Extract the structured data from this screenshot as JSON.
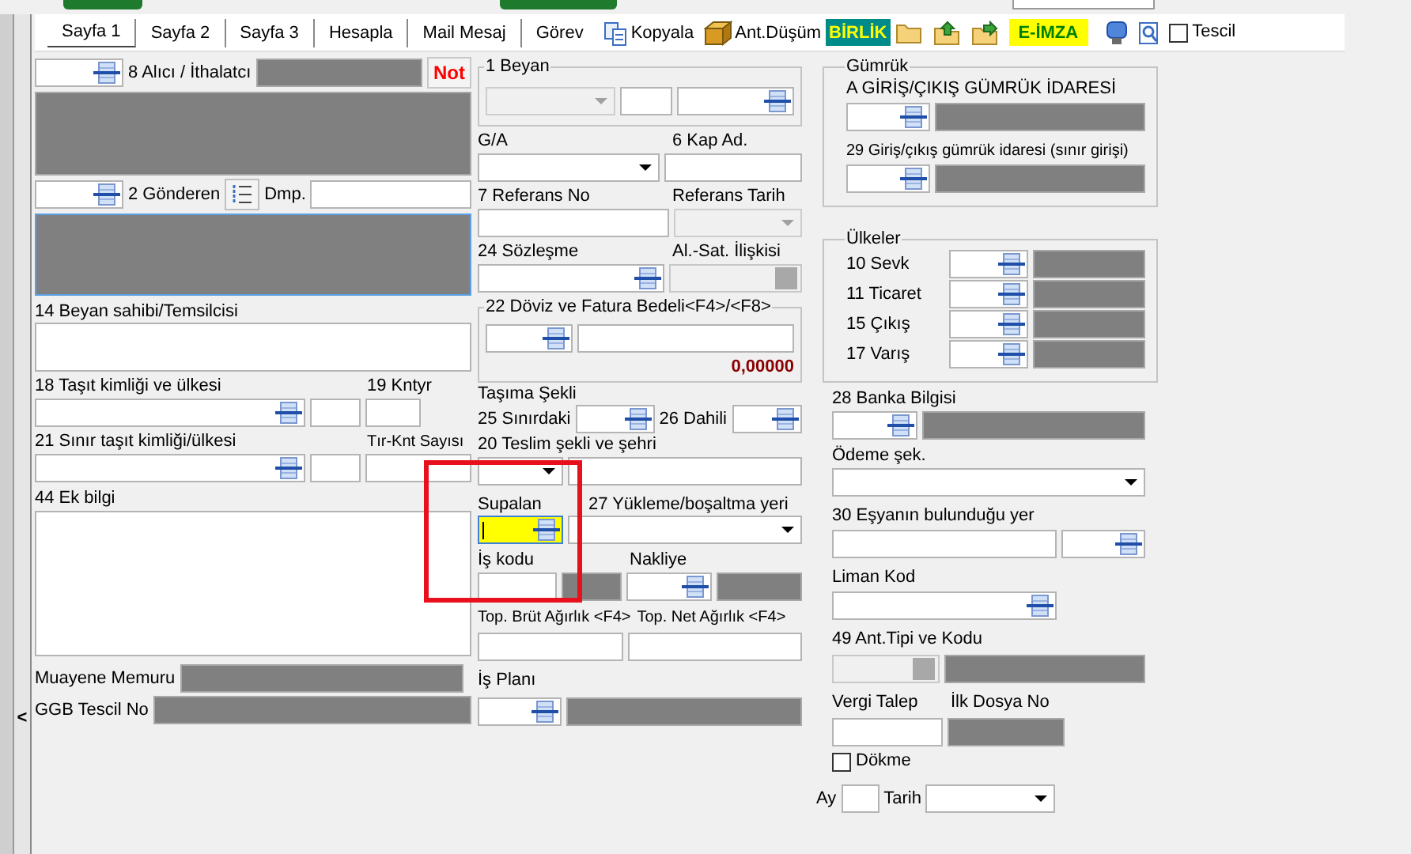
{
  "rail": {
    "collapse_glyph": "<"
  },
  "toolbar": {
    "tabs": [
      {
        "label": "Sayfa 1",
        "selected": true
      },
      {
        "label": "Sayfa 2",
        "selected": false
      },
      {
        "label": "Sayfa 3",
        "selected": false
      },
      {
        "label": "Hesapla",
        "selected": false
      },
      {
        "label": "Mail Mesaj",
        "selected": false
      },
      {
        "label": "Görev",
        "selected": false
      }
    ],
    "copy_button": {
      "label": "Kopyala"
    },
    "ant_button": {
      "label": "Ant.Düşüm"
    },
    "birlik_button": {
      "label": "BİRLİK"
    },
    "eimza_button": {
      "label": "E-İMZA"
    },
    "tescil": {
      "label": "Tescil",
      "checked": false
    }
  },
  "left": {
    "alici": {
      "label": "8 Alıcı / İthalatcı",
      "note_button": "Not"
    },
    "gonderen": {
      "label": "2 Gönderen",
      "dmp_label": "Dmp."
    },
    "beyan_sahibi": {
      "label": "14 Beyan sahibi/Temsilcisi"
    },
    "tasit": {
      "label": "18 Taşıt kimliği ve ülkesi",
      "kntyr_label": "19 Kntyr"
    },
    "sinir_tasit": {
      "label": "21 Sınır taşıt kimliği/ülkesi",
      "count_label": "Tır-Knt Sayısı"
    },
    "ek_bilgi": {
      "label": "44 Ek bilgi"
    },
    "muayene": {
      "label": "Muayene Memuru"
    },
    "ggb": {
      "label": "GGB Tescil No"
    }
  },
  "middle": {
    "beyan": {
      "legend": "1 Beyan",
      "disabled": true
    },
    "ga": {
      "label": "G/A"
    },
    "kap": {
      "label": "6 Kap Ad."
    },
    "referans_no": {
      "label": "7 Referans No"
    },
    "referans_tarih": {
      "label": "Referans Tarih",
      "disabled": true
    },
    "sozlesme": {
      "label": "24 Sözleşme"
    },
    "al_sat": {
      "label": "Al.-Sat. İlişkisi",
      "disabled": true
    },
    "doviz": {
      "legend": "22 Döviz ve Fatura Bedeli<F4>/<F8>",
      "amount": "0,00000"
    },
    "tasima": {
      "label": "Taşıma Şekli",
      "sinirdaki": "25 Sınırdaki",
      "dahili": "26 Dahili"
    },
    "teslim": {
      "label": "20 Teslim şekli ve şehri"
    },
    "supalan": {
      "label": "Supalan",
      "focused": true
    },
    "yukleme": {
      "label": "27 Yükleme/boşaltma yeri"
    },
    "is_kodu": {
      "label": "İş kodu"
    },
    "nakliye": {
      "label": "Nakliye"
    },
    "brut": {
      "label": "Top. Brüt Ağırlık <F4>"
    },
    "net": {
      "label": "Top. Net Ağırlık <F4>"
    },
    "is_plani": {
      "label": "İş Planı"
    }
  },
  "right": {
    "gumruk": {
      "legend": "Gümrük",
      "items": [
        {
          "label": "A GİRİŞ/ÇIKIŞ GÜMRÜK İDARESİ"
        },
        {
          "label": "29 Giriş/çıkış gümrük idaresi (sınır girişi)"
        }
      ]
    },
    "ulkeler": {
      "legend": "Ülkeler",
      "items": [
        {
          "label": "10 Sevk"
        },
        {
          "label": "11 Ticaret"
        },
        {
          "label": "15 Çıkış"
        },
        {
          "label": "17 Varış"
        }
      ]
    },
    "banka": {
      "label": "28 Banka Bilgisi"
    },
    "odeme": {
      "label": "Ödeme şek."
    },
    "esya_yeri": {
      "label": "30 Eşyanın bulunduğu yer"
    },
    "liman": {
      "label": "Liman Kod"
    },
    "ant_tipi": {
      "label": "49 Ant.Tipi ve Kodu",
      "disabled": true
    },
    "vergi_talep": {
      "label": "Vergi Talep"
    },
    "ilk_dosya": {
      "label": "İlk Dosya No"
    },
    "dokme": {
      "label": "Dökme",
      "checked": false
    },
    "ay": {
      "label": "Ay"
    },
    "tarih": {
      "label": "Tarih"
    }
  },
  "annotations": [
    {
      "kind": "rectangle"
    }
  ]
}
